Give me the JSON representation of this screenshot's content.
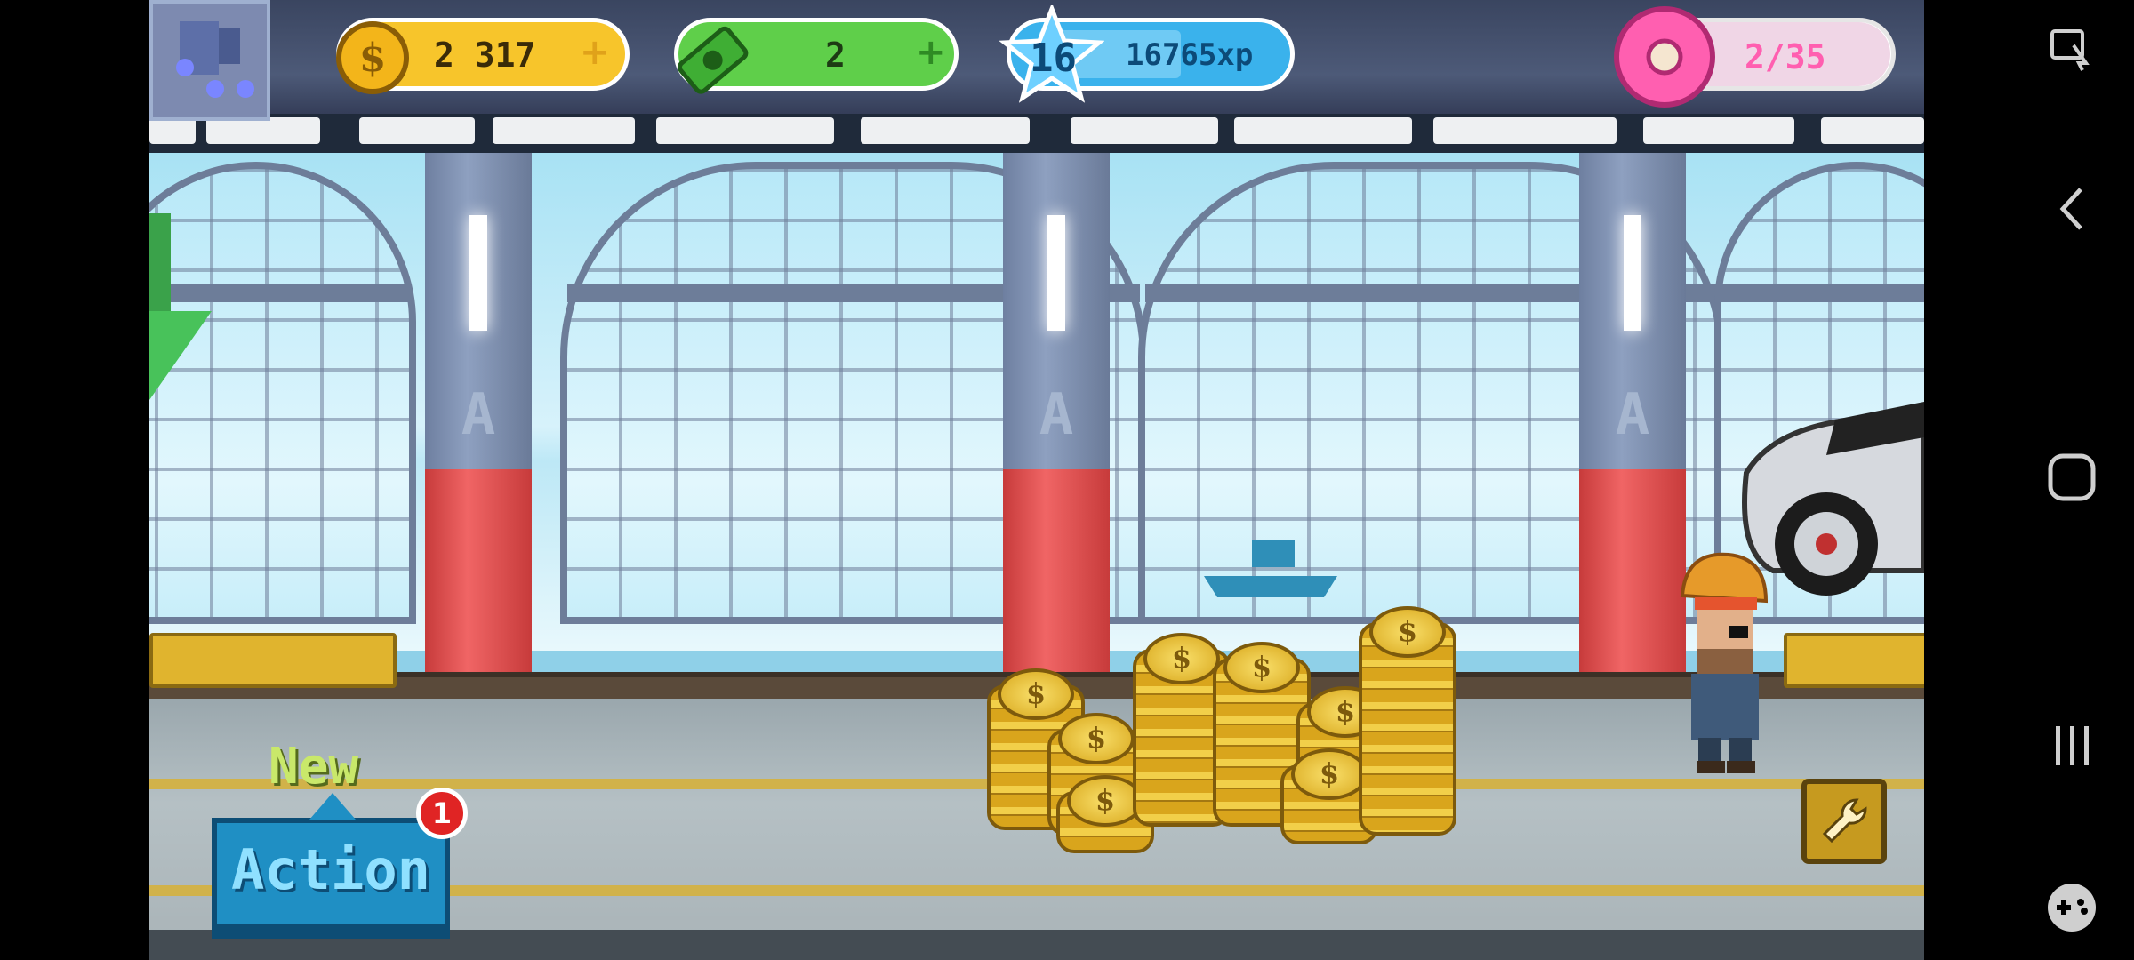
{
  "hud": {
    "coins": "2 317",
    "cash": "2",
    "level": "16",
    "xp": "16765xp",
    "donuts": "2/35",
    "colors": {
      "coin": "#f7c52b",
      "cash": "#5fcf4a",
      "xp": "#3ab2ec",
      "donut": "#ff5fb0"
    }
  },
  "action": {
    "new_label": "New",
    "button_label": "Action",
    "badge": "1"
  },
  "icons": {
    "avatar": "character-avatar-icon",
    "coin": "dollar-coin-icon",
    "cash": "cash-bill-icon",
    "level": "star-level-icon",
    "donut": "donut-icon",
    "tools": "wrench-icon",
    "system": [
      "screenshot-edit-icon",
      "back-icon",
      "home-icon",
      "recents-icon",
      "gamepad-icon"
    ]
  }
}
